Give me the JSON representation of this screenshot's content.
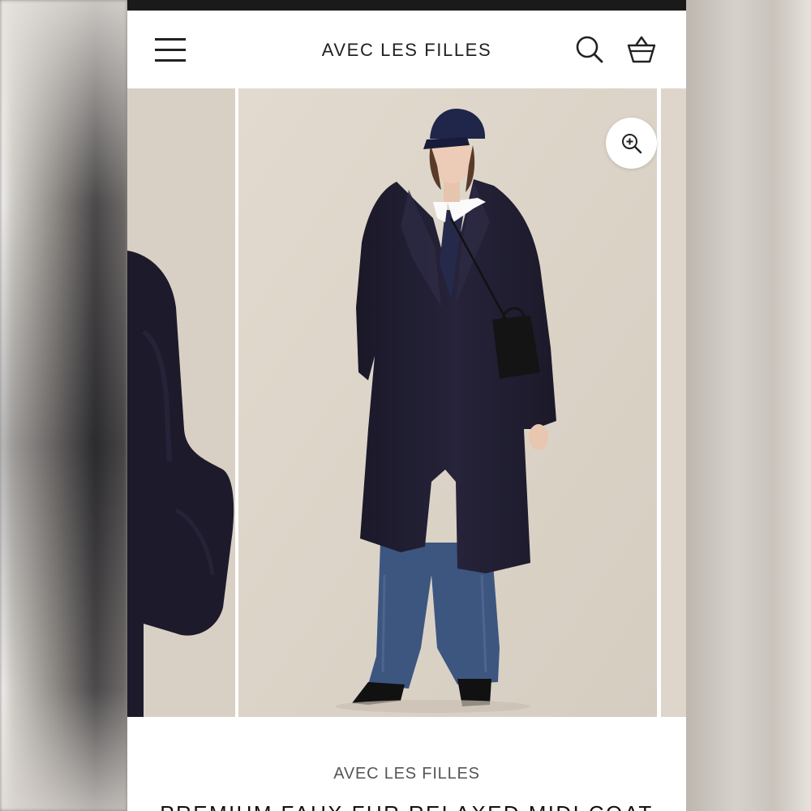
{
  "header": {
    "brand": "AVEC LES FILLES",
    "menu_icon": "hamburger-menu-icon",
    "search_icon": "search-icon",
    "cart_icon": "basket-icon"
  },
  "gallery": {
    "zoom_icon": "zoom-in-icon",
    "images": [
      "coat-detail",
      "model-full-length",
      "next-image"
    ]
  },
  "product": {
    "brand": "AVEC LES FILLES",
    "title": "PREMIUM FAUX FUR RELAXED MIDI COAT"
  },
  "colors": {
    "coat": "#1e1c2e",
    "jeans": "#3d5680",
    "backdrop": "#ddd5ca"
  }
}
